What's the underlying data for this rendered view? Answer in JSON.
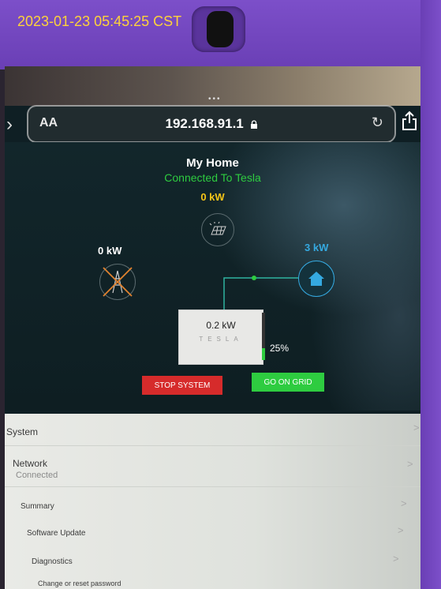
{
  "photo": {
    "timestamp": "2023-01-23 05:45:25 CST"
  },
  "browser": {
    "aa_label": "AA",
    "url": "192.168.91.1",
    "lock_icon": "lock-icon",
    "reload_icon": "reload-icon",
    "share_icon": "share-icon"
  },
  "dashboard": {
    "title": "My Home",
    "status": "Connected To Tesla",
    "solar": {
      "power": "0 kW",
      "icon": "solar-panel-icon"
    },
    "grid": {
      "power": "0 kW",
      "icon": "grid-tower-disconnected-icon"
    },
    "home": {
      "power": "3 kW",
      "icon": "home-icon"
    },
    "battery": {
      "power": "0.2 kW",
      "brand": "TESLA",
      "charge_label": "25%",
      "charge_fraction": 0.25
    },
    "stop_button": "STOP SYSTEM",
    "grid_button": "GO ON GRID",
    "colors": {
      "solar": "#f5c518",
      "home": "#35a9e0",
      "status": "#2ecc40",
      "stop": "#d62b2b",
      "go": "#2ecc40"
    }
  },
  "menu": {
    "system": "System",
    "network": "Network",
    "network_status": "Connected",
    "summary": "Summary",
    "software_update": "Software Update",
    "diagnostics": "Diagnostics",
    "change_password": "Change or reset password",
    "chevron": ">"
  }
}
